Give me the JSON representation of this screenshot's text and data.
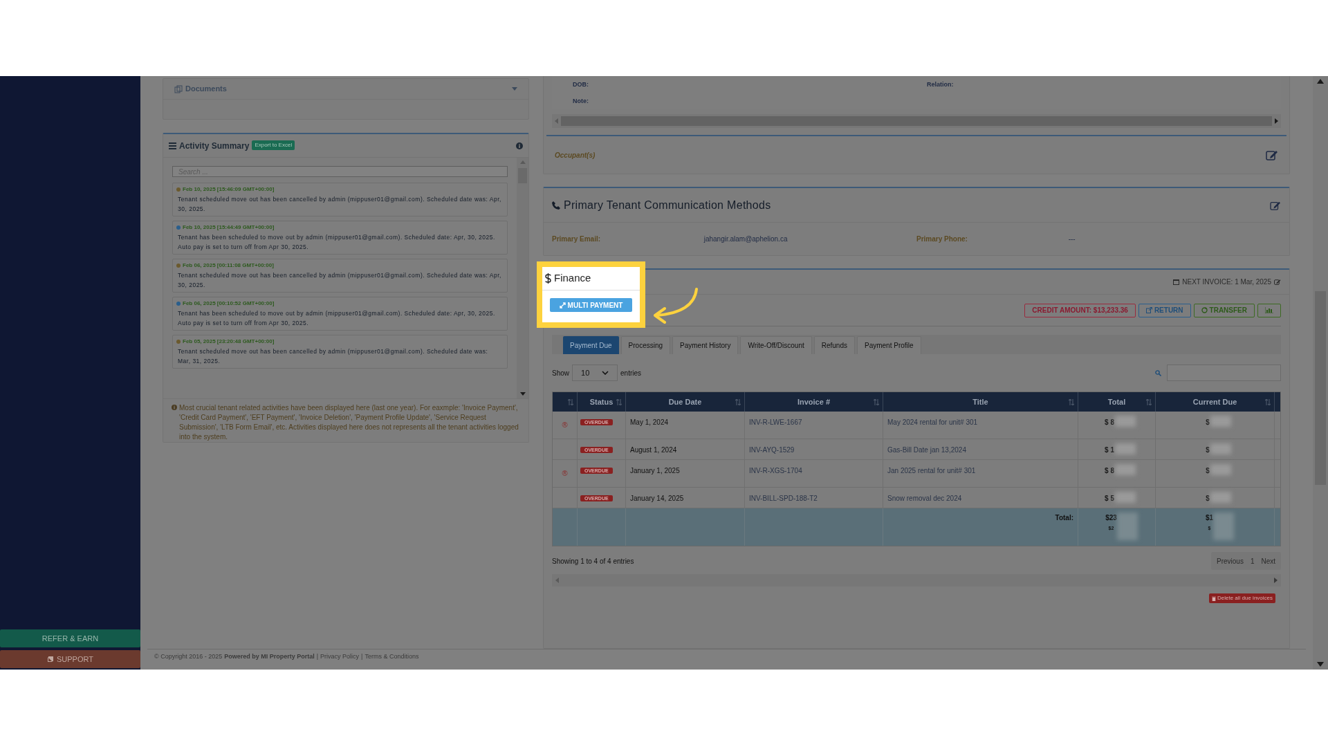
{
  "sidebar": {
    "buttons": [
      {
        "label": "REFER & EARN",
        "kind": "refer"
      },
      {
        "label": "SUPPORT",
        "kind": "support"
      }
    ]
  },
  "documents_panel": {
    "title": "Documents"
  },
  "activity_summary": {
    "title": "Activity Summary",
    "export_button": "Export to Excel",
    "search": {
      "placeholder": "Search ..."
    },
    "entries": [
      {
        "timestamp": "Feb 10, 2025 [15:46:09 GMT+00:00]",
        "color": "#6b5a2e",
        "text": "Tenant scheduled move out has been cancelled by admin (mippuser01@gmail.com). Scheduled date was: Apr, 30, 2025."
      },
      {
        "timestamp": "Feb 10, 2025 [15:44:49 GMT+00:00]",
        "color": "#2a5e8c",
        "text": "Tenant has been scheduled to move out by admin (mippuser01@gmail.com). Scheduled date: Apr, 30, 2025. Auto pay is set to turn off from Apr 30, 2025."
      },
      {
        "timestamp": "Feb 06, 2025 [00:11:08 GMT+00:00]",
        "color": "#6b5a2e",
        "text": "Tenant scheduled move out has been cancelled by admin (mippuser01@gmail.com). Scheduled date was: Apr, 30, 2025."
      },
      {
        "timestamp": "Feb 06, 2025 [00:10:52 GMT+00:00]",
        "color": "#2a5e8c",
        "text": "Tenant has been scheduled to move out by admin (mippuser01@gmail.com). Scheduled date: Apr, 30, 2025. Auto pay is set to turn off from Apr 30, 2025."
      },
      {
        "timestamp": "Feb 05, 2025 [23:20:48 GMT+00:00]",
        "color": "#6b5a2e",
        "text": "Tenant scheduled move out has been cancelled by admin (mippuser01@gmail.com). Scheduled date was: Mar, 31, 2025."
      }
    ],
    "note": "Most crucial tenant related activities have been displayed here (last one year). For eaxmple: 'Invoice Payment', 'Credit Card Payment', 'EFT Payment', 'Invoice Deletion', 'Payment Profile Update', 'Service Request Submission', 'LTB Form Email', etc. Activities displayed here does not represents all the tenant activities logged into the system."
  },
  "occupant_details": {
    "fields": [
      "DOB:",
      "Relation:",
      "Note:"
    ],
    "section_title": "Occupant(s)"
  },
  "communication": {
    "title": "Primary Tenant Communication Methods",
    "fields": [
      {
        "label": "Primary Email:",
        "value": "jahangir.alam@aphelion.ca"
      },
      {
        "label": "Primary Phone:",
        "value": "---"
      }
    ]
  },
  "finance": {
    "title": "Finance",
    "multi_payment_button": "MULTI PAYMENT",
    "next_invoice": "NEXT INVOICE: 1 Mar, 2025",
    "actions": [
      {
        "kind": "credit",
        "label": "CREDIT AMOUNT: $13,233.36"
      },
      {
        "kind": "return",
        "label": "RETURN"
      },
      {
        "kind": "transfer",
        "label": "TRANSFER"
      },
      {
        "kind": "chart"
      }
    ],
    "tabs": [
      {
        "label": "Payment Due",
        "selected": true
      },
      {
        "label": "Processing",
        "selected": false
      },
      {
        "label": "Payment History",
        "selected": false
      },
      {
        "label": "Write-Off/Discount",
        "selected": false
      },
      {
        "label": "Refunds",
        "selected": false
      },
      {
        "label": "Payment Profile",
        "selected": false
      }
    ],
    "show_label": "Show",
    "page_size": "10",
    "entries_label": "entries",
    "table": {
      "columns": [
        "",
        "Status",
        "Due Date",
        "Invoice #",
        "Title",
        "Total",
        "Current Due"
      ],
      "rows": [
        {
          "mark": "®",
          "status": "OVERDUE",
          "due_date": "May 1, 2024",
          "invoice": "INV-R-LWE-1667",
          "title": "May 2024 rental for unit# 301",
          "total": "$ 8",
          "current_due": "$"
        },
        {
          "status": "OVERDUE",
          "due_date": "August 1, 2024",
          "invoice": "INV-AYQ-1529",
          "title": "Gas-Bill Date jan 13,2024",
          "total": "$ 1",
          "current_due": "$"
        },
        {
          "mark": "®",
          "status": "OVERDUE",
          "due_date": "January 1, 2025",
          "invoice": "INV-R-XGS-1704",
          "title": "Jan 2025 rental for unit# 301",
          "total": "$ 8",
          "current_due": "$"
        },
        {
          "status": "OVERDUE",
          "due_date": "January 14, 2025",
          "invoice": "INV-BILL-SPD-188-T2",
          "title": "Snow removal dec 2024",
          "total": "$ 5",
          "current_due": "$"
        }
      ],
      "total_row": {
        "label": "Total:",
        "total": "$23",
        "total_sub": "$2",
        "current_due": "$1",
        "current_due_sub": "$"
      }
    },
    "info": "Showing 1 to 4 of 4 entries",
    "pagination": {
      "previous": "Previous",
      "page": "1",
      "next": "Next"
    },
    "delete_button": "Delete all due invoices"
  },
  "footer": {
    "copyright": "© Copyright 2016 - 2025",
    "powered": "Powered by MI Property Portal",
    "separator": "|",
    "links": [
      "Privacy Policy",
      "Terms & Conditions"
    ]
  }
}
